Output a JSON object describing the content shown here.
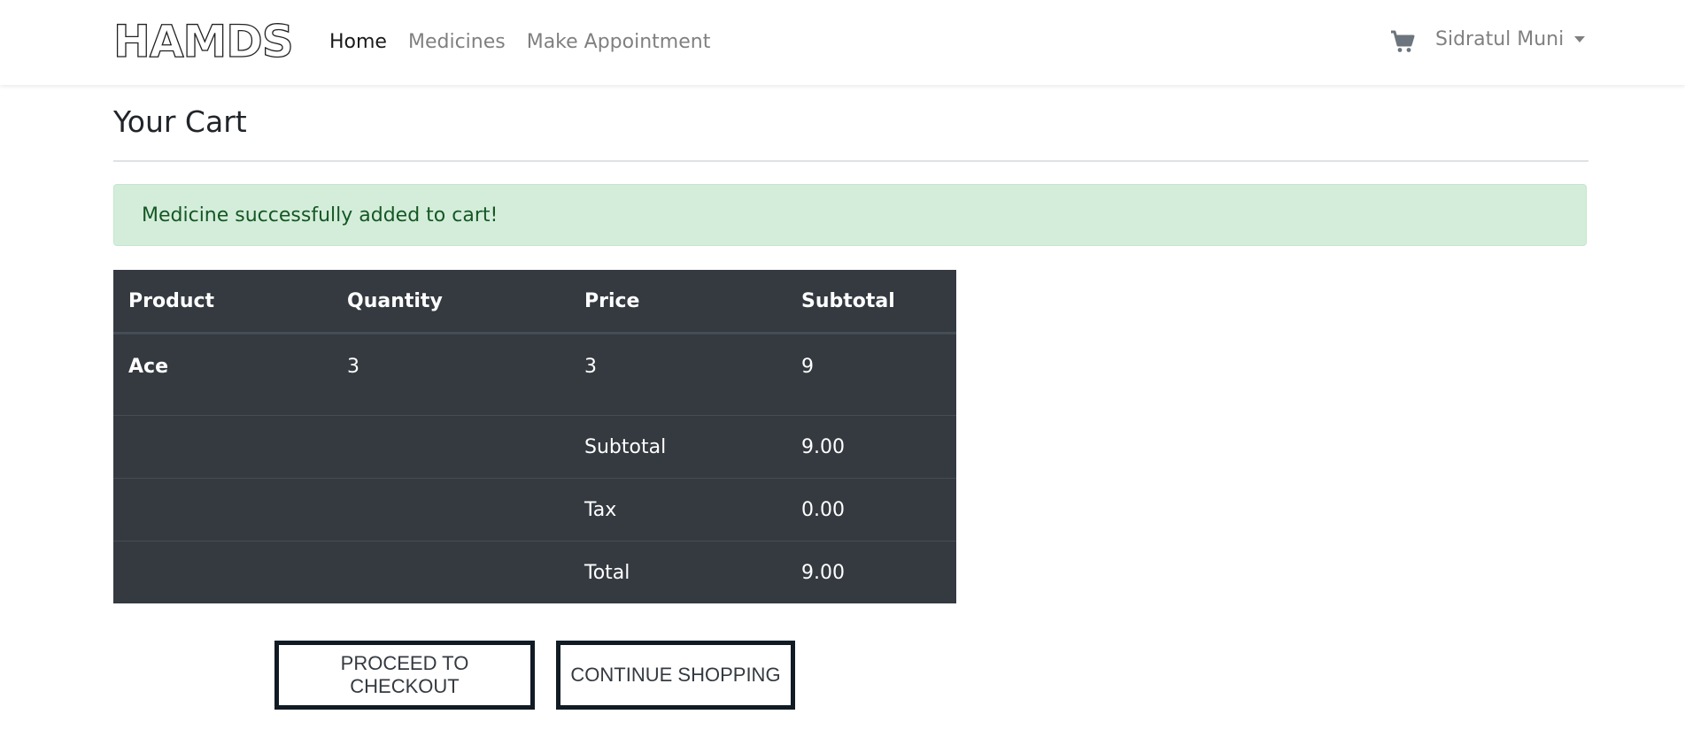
{
  "brand": {
    "logo_text": "HAMDS"
  },
  "nav": {
    "links": [
      {
        "label": "Home",
        "active": true
      },
      {
        "label": "Medicines",
        "active": false
      },
      {
        "label": "Make Appointment",
        "active": false
      }
    ],
    "cart_icon": "shopping-cart-icon",
    "user_name": "Sidratul Muni"
  },
  "page": {
    "title": "Your Cart"
  },
  "alert": {
    "message": "Medicine successfully added to cart!",
    "color": "#d4edda"
  },
  "cart": {
    "headers": [
      "Product",
      "Quantity",
      "Price",
      "Subtotal"
    ],
    "items": [
      {
        "product": "Ace",
        "quantity": "3",
        "price": "3",
        "subtotal": "9"
      }
    ],
    "summary": [
      {
        "label": "Subtotal",
        "value": "9.00"
      },
      {
        "label": "Tax",
        "value": "0.00"
      },
      {
        "label": "Total",
        "value": "9.00"
      }
    ]
  },
  "actions": {
    "checkout_label": "PROCEED TO CHECKOUT",
    "continue_label": "CONTINUE SHOPPING"
  }
}
